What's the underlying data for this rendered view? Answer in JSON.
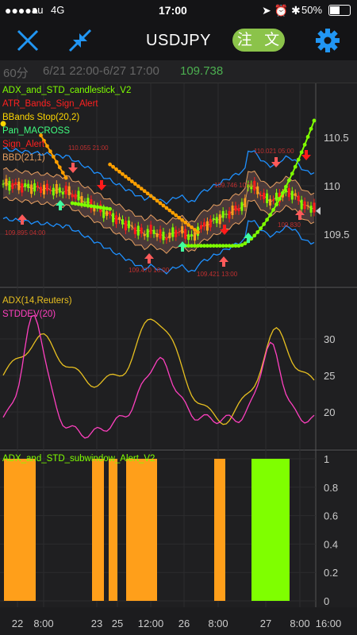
{
  "status_bar": {
    "carrier": "au",
    "network": "4G",
    "time": "17:00",
    "battery": "50%"
  },
  "header": {
    "symbol": "USDJPY",
    "order_label": "注 文"
  },
  "info": {
    "timeframe": "60分",
    "range": "6/21 22:00-6/27 17:00",
    "price": "109.738"
  },
  "indicators": {
    "main": [
      {
        "label": "ADX_and_STD_candlestick_V2",
        "color": "#7fff00"
      },
      {
        "label": "ATR_Bands_Sign_Alert",
        "color": "#ff2020"
      },
      {
        "label": "BBands Stop(20,2)",
        "color": "#ffd700"
      },
      {
        "label": "Pan_MACROSS",
        "color": "#40ff80"
      },
      {
        "label": "Sign_Alert",
        "color": "#ff2020"
      },
      {
        "label": "BBD(21,1)",
        "color": "#e8a060"
      }
    ],
    "sub1": [
      {
        "label": "ADX(14,Reuters)",
        "color": "#e8c020"
      },
      {
        "label": "STDDEV(20)",
        "color": "#ff40c0"
      }
    ],
    "sub2": [
      {
        "label": "ADX_and_STD_subwindow_Alert_V2",
        "color": "#7fff00"
      }
    ]
  },
  "price_axis": {
    "ticks": [
      "110.5",
      "110",
      "109.5"
    ],
    "current": "109.738"
  },
  "annotations": [
    {
      "text": "110.055 21:00"
    },
    {
      "text": "109.895 04:00"
    },
    {
      "text": "109.470 16:00"
    },
    {
      "text": "109.746 10:00"
    },
    {
      "text": "109.421 13:00"
    },
    {
      "text": "110.021 05:00"
    },
    {
      "text": "109.830"
    }
  ],
  "adx_axis": {
    "ticks": [
      "30",
      "25",
      "20"
    ]
  },
  "alert_axis": {
    "ticks": [
      "1",
      "0.8",
      "0.6",
      "0.4",
      "0.2",
      "0"
    ]
  },
  "time_axis": {
    "labels": [
      "22",
      "8:00",
      "23",
      "25",
      "12:00",
      "26",
      "8:00",
      "27",
      "8:00",
      "16:00"
    ]
  },
  "colors": {
    "up": "#7fff00",
    "down": "#ff1a1a",
    "band": "#1e90ff",
    "stop": "#ffa000",
    "orange_bar": "#ff9f1a",
    "green_bar": "#7fff00"
  }
}
